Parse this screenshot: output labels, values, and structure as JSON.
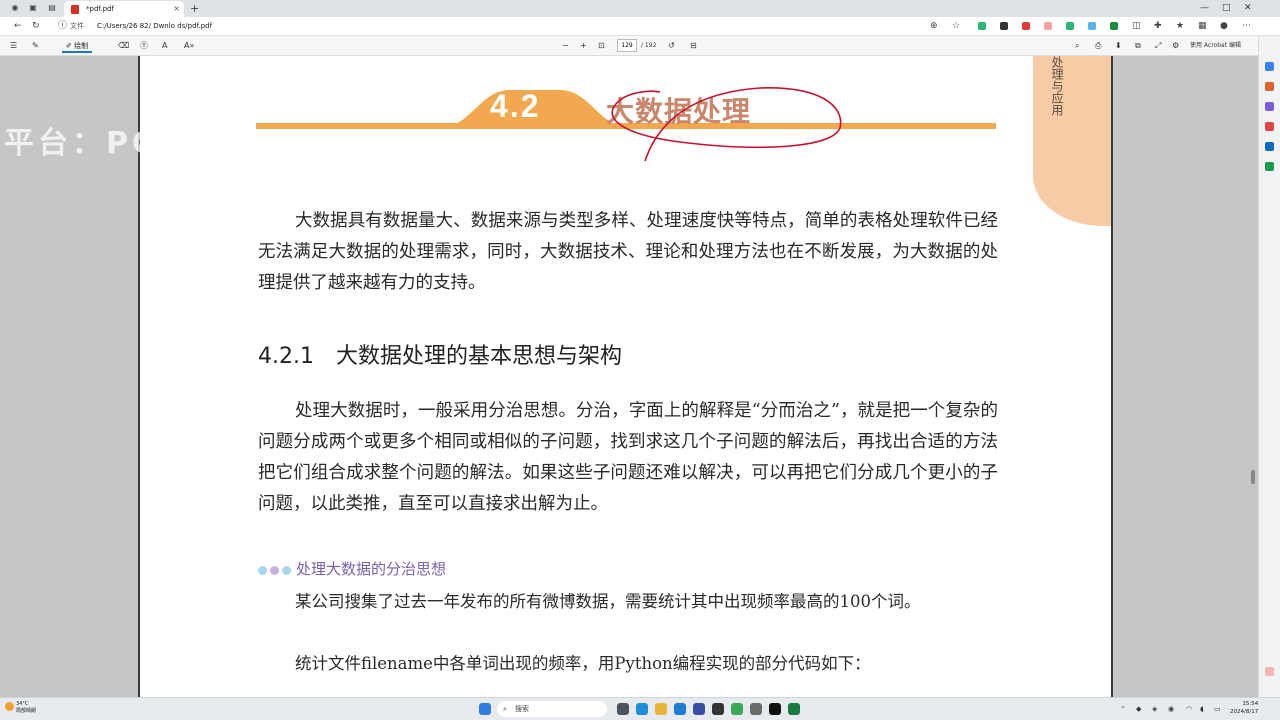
{
  "browser": {
    "tab_title": "*pdf.pdf",
    "tab_close": "×",
    "new_tab": "+",
    "url_prefix": "文件",
    "url": "C:/Users/26 82/ Dwnlo ds/pdf.pdf",
    "window_controls": [
      "—",
      "□",
      "✕"
    ]
  },
  "pdf_toolbar": {
    "draw_label": "绘制",
    "zoom_out": "−",
    "zoom_in": "+",
    "page_current": "129",
    "page_total": "/ 192"
  },
  "sidebar_right": {
    "acrobat_label": "使用 Acrobat 编辑"
  },
  "watermark": {
    "text": "平台：PC"
  },
  "document": {
    "chapter_number": "4.2",
    "chapter_title": "大数据处理",
    "side_tab": "处理与应用",
    "intro_paragraph": "大数据具有数据量大、数据来源与类型多样、处理速度快等特点，简单的表格处理软件已经无法满足大数据的处理需求，同时，大数据技术、理论和处理方法也在不断发展，为大数据的处理提供了越来越有力的支持。",
    "section_number": "4.2.1",
    "section_title": "大数据处理的基本思想与架构",
    "section_paragraph": "处理大数据时，一般采用分治思想。分治，字面上的解释是“分而治之”，就是把一个复杂的问题分成两个或更多个相同或相似的子问题，找到求这几个子问题的解法后，再找出合适的方法把它们组合成求整个问题的解法。如果这些子问题还难以解决，可以再把它们分成几个更小的子问题，以此类推，直至可以直接求出解为止。",
    "subheading": "处理大数据的分治思想",
    "line_1": "某公司搜集了过去一年发布的所有微博数据，需要统计其中出现频率最高的100个词。",
    "line_2": "统计文件filename中各单词出现的频率，用Python编程实现的部分代码如下："
  },
  "taskbar": {
    "weather_temp": "34°C",
    "weather_desc": "局部晴朗",
    "search_label": "搜索",
    "time": "15:54",
    "date": "2024/8/17"
  },
  "colors": {
    "banner": "#f2a84e",
    "chapter_title": "#c9866a",
    "side_tab": "#f7cba5",
    "subheading": "#7a5fb0",
    "annotation": "#c8102e"
  }
}
